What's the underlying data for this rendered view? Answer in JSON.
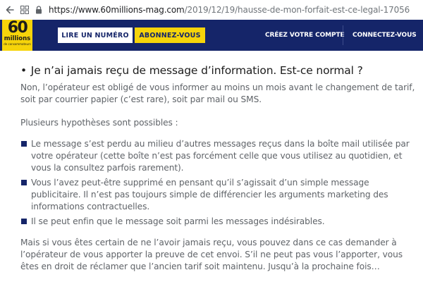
{
  "browser": {
    "url_host": "https://www.60millions-mag.com",
    "url_path": "/2019/12/19/hausse-de-mon-forfait-est-ce-legal-17056",
    "back_icon": "arrow-left-icon",
    "apps_icon": "apps-grid-icon",
    "lock_icon": "lock-icon"
  },
  "header": {
    "logo": {
      "number": "60",
      "word": "millions",
      "sub": "de consommateurs"
    },
    "read_issue_label": "LIRE UN NUMÉRO",
    "subscribe_label": "ABONNEZ-VOUS",
    "create_account_label": "CRÉEZ VOTRE COMPTE",
    "connect_label": "CONNECTEZ-VOUS",
    "colors": {
      "navy": "#152569",
      "yellow": "#f6d40a"
    }
  },
  "article": {
    "bullet": "•",
    "question": "Je n’ai jamais reçu de message d’information. Est-ce normal ?",
    "intro": "Non, l’opérateur est obligé de vous informer au moins un mois avant le changement de tarif, soit par courrier papier (c’est rare), soit par mail ou SMS.",
    "hypotheses_intro": "Plusieurs hypothèses sont possibles :",
    "hypotheses": [
      "Le message s’est perdu au milieu d’autres messages reçus dans la boîte mail utilisée par votre opérateur (cette boîte n’est pas forcément celle que vous utilisez au quotidien, et vous la consultez parfois rarement).",
      "Vous l’avez peut-être supprimé en pensant qu’il s’agissait d’un simple message publicitaire. Il n’est pas toujours simple de différencier les arguments marketing des informations contractuelles.",
      "Il se peut enfin que le message soit parmi les messages indésirables."
    ],
    "conclusion": "Mais si vous êtes certain de ne l’avoir jamais reçu, vous pouvez dans ce cas demander à l’opérateur de vous apporter la preuve de cet envoi. S’il ne peut pas vous l’apporter, vous êtes en droit de réclamer que l’ancien tarif soit maintenu. Jusqu’à la prochaine fois…"
  }
}
